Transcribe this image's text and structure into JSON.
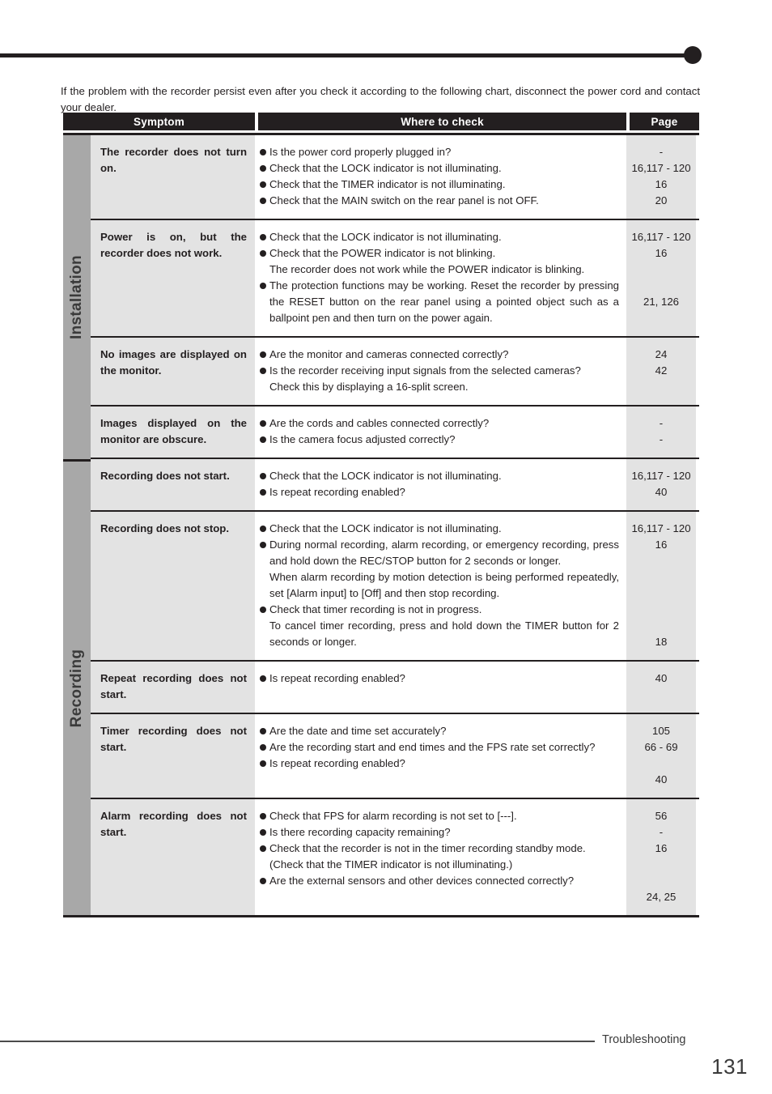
{
  "intro": "If the problem with the recorder persist even after you check it according to the following chart, disconnect the power cord and contact your dealer.",
  "table": {
    "headers": {
      "symptom": "Symptom",
      "where": "Where to check",
      "page": "Page"
    },
    "groups": [
      {
        "label": "Installation",
        "rows": [
          {
            "symptom": "The recorder does not turn on.",
            "checks": [
              {
                "bullet": true,
                "text": "Is the power cord properly plugged in?"
              },
              {
                "bullet": true,
                "text": "Check that the LOCK indicator is not illuminating."
              },
              {
                "bullet": true,
                "text": "Check that the TIMER indicator is not illuminating."
              },
              {
                "bullet": true,
                "text": "Check that the MAIN switch on the rear panel is not OFF."
              }
            ],
            "pages": [
              "-",
              "16,117 - 120",
              "16",
              "20"
            ]
          },
          {
            "symptom": "Power is on, but the recorder does not work.",
            "checks": [
              {
                "bullet": true,
                "text": "Check that the LOCK indicator is not illuminating."
              },
              {
                "bullet": true,
                "text": "Check that the POWER indicator is not blinking."
              },
              {
                "bullet": false,
                "text": "The recorder does not work while the POWER indicator is blinking."
              },
              {
                "bullet": true,
                "text": "The protection functions may be working. Reset the recorder by pressing the RESET button on the rear panel using a pointed object such as a ballpoint pen and then turn on the power again."
              }
            ],
            "pages": [
              "16,117 - 120",
              "16",
              "",
              "",
              "21, 126"
            ]
          },
          {
            "symptom": "No images are displayed on the monitor.",
            "checks": [
              {
                "bullet": true,
                "text": "Are the monitor and cameras connected correctly?"
              },
              {
                "bullet": true,
                "text": "Is the recorder receiving input signals from the selected cameras?"
              },
              {
                "bullet": false,
                "text": "Check this by displaying a 16-split screen."
              }
            ],
            "pages": [
              "24",
              "42"
            ]
          },
          {
            "symptom": "Images displayed on the monitor are obscure.",
            "checks": [
              {
                "bullet": true,
                "text": "Are the cords and cables connected correctly?"
              },
              {
                "bullet": true,
                "text": "Is the camera focus adjusted correctly?"
              }
            ],
            "pages": [
              "-",
              "-"
            ]
          }
        ]
      },
      {
        "label": "Recording",
        "rows": [
          {
            "symptom": "Recording does not start.",
            "checks": [
              {
                "bullet": true,
                "text": "Check that the LOCK indicator is not illuminating."
              },
              {
                "bullet": true,
                "text": "Is repeat recording enabled?"
              }
            ],
            "pages": [
              "16,117 - 120",
              "40"
            ]
          },
          {
            "symptom": "Recording does not stop.",
            "checks": [
              {
                "bullet": true,
                "text": "Check that the LOCK indicator is not illuminating."
              },
              {
                "bullet": true,
                "text": "During normal recording, alarm recording, or emergency recording, press and hold down the REC/STOP button for 2 seconds or longer."
              },
              {
                "bullet": false,
                "text": "When alarm recording by motion detection is being performed repeatedly, set [Alarm input] to [Off] and then stop recording."
              },
              {
                "bullet": true,
                "text": "Check that timer recording is not in progress."
              },
              {
                "bullet": false,
                "text": "To cancel timer recording, press and hold down the TIMER button for 2 seconds or longer."
              }
            ],
            "pages": [
              "16,117 - 120",
              "16",
              "",
              "",
              "",
              "",
              "",
              "18"
            ]
          },
          {
            "symptom": "Repeat recording does not start.",
            "checks": [
              {
                "bullet": true,
                "text": "Is repeat recording enabled?"
              }
            ],
            "pages": [
              "40"
            ]
          },
          {
            "symptom": "Timer recording does not start.",
            "checks": [
              {
                "bullet": true,
                "text": "Are the date and time set accurately?"
              },
              {
                "bullet": true,
                "text": "Are the recording start and end times and the FPS rate set correctly?"
              },
              {
                "bullet": true,
                "text": "Is repeat recording enabled?"
              }
            ],
            "pages": [
              "105",
              "66 - 69",
              "",
              "40"
            ]
          },
          {
            "symptom": "Alarm recording does not start.",
            "checks": [
              {
                "bullet": true,
                "text": "Check that FPS for alarm recording is not set to [---]."
              },
              {
                "bullet": true,
                "text": "Is there recording capacity remaining?"
              },
              {
                "bullet": true,
                "text": "Check that the recorder is not in the timer recording standby mode."
              },
              {
                "bullet": false,
                "text": "(Check that the TIMER indicator is not illuminating.)"
              },
              {
                "bullet": true,
                "text": "Are the external sensors and other devices connected correctly?"
              }
            ],
            "pages": [
              "56",
              "-",
              "16",
              "",
              "",
              "24, 25"
            ]
          }
        ]
      }
    ]
  },
  "footer": {
    "section": "Troubleshooting",
    "page_number": "131"
  }
}
